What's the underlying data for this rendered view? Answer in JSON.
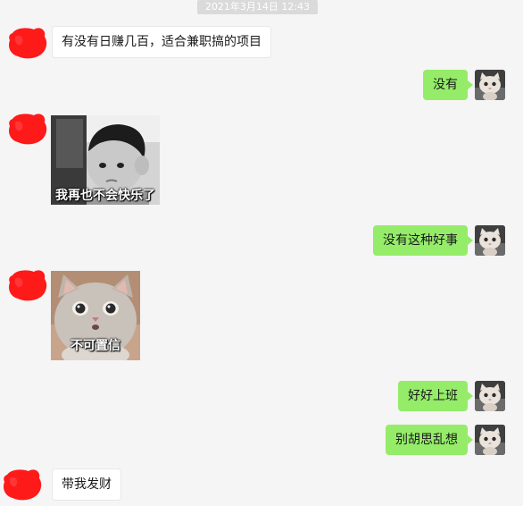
{
  "timestamp": "2021年3月14日 12:43",
  "colors": {
    "background": "#f5f5f5",
    "outgoing_bubble": "#95ec69",
    "incoming_bubble": "#ffffff",
    "redacted": "#ff1a1a"
  },
  "messages": [
    {
      "side": "left",
      "type": "text",
      "text": "有没有日赚几百，适合兼职搞的项目"
    },
    {
      "side": "right",
      "type": "text",
      "text": "没有"
    },
    {
      "side": "left",
      "type": "sticker",
      "caption": "我再也不会快乐了"
    },
    {
      "side": "right",
      "type": "text",
      "text": "没有这种好事"
    },
    {
      "side": "left",
      "type": "sticker",
      "caption": "不可置信"
    },
    {
      "side": "right",
      "type": "text",
      "text": "好好上班"
    },
    {
      "side": "right",
      "type": "text",
      "text": "别胡思乱想"
    },
    {
      "side": "left",
      "type": "text",
      "text": "带我发财"
    }
  ],
  "icons": {
    "left_avatar": "redacted-avatar-icon",
    "right_avatar": "cat-avatar-icon"
  }
}
